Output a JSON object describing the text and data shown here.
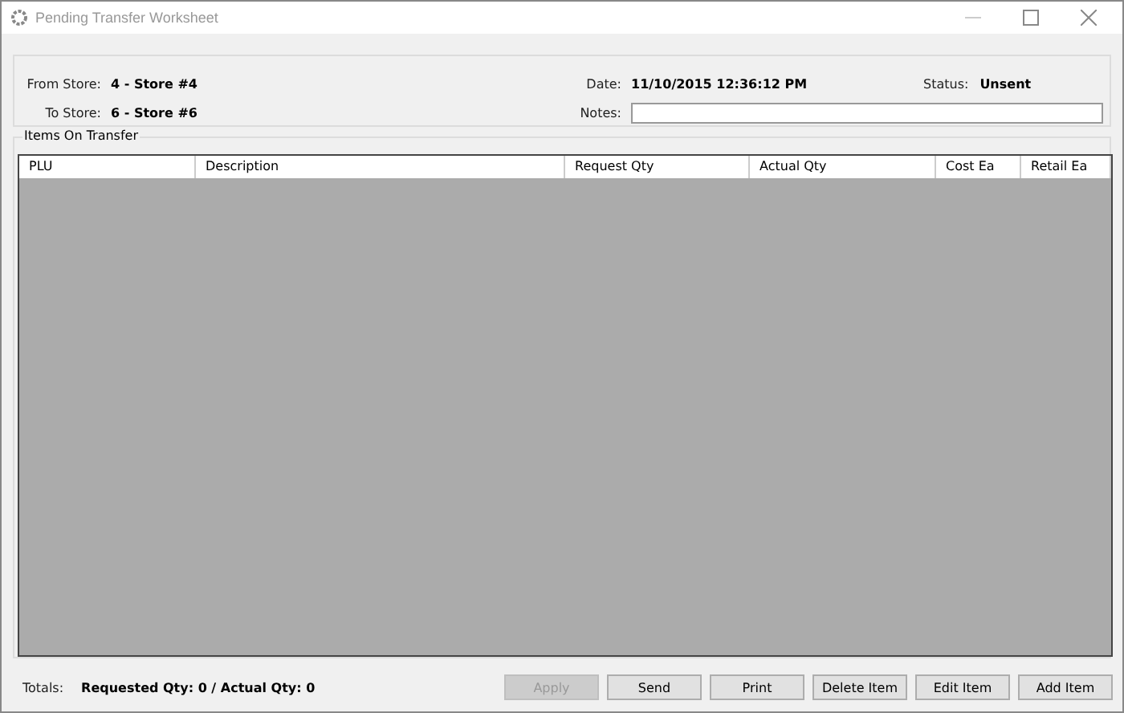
{
  "window": {
    "title": "Pending Transfer Worksheet"
  },
  "header": {
    "from_store_label": "From Store:",
    "from_store": "4 - Store #4",
    "to_store_label": "To Store:",
    "to_store": "6 - Store #6",
    "date_label": "Date:",
    "date": "11/10/2015 12:36:12 PM",
    "status_label": "Status:",
    "status": "Unsent",
    "notes_label": "Notes:"
  },
  "items_group": {
    "title": "Items On Transfer",
    "columns": [
      {
        "label": "PLU"
      },
      {
        "label": "Description"
      },
      {
        "label": "Request Qty"
      },
      {
        "label": "Actual Qty"
      },
      {
        "label": "Cost Ea"
      },
      {
        "label": "Retail Ea"
      }
    ]
  },
  "footer": {
    "totals_label": "Totals:",
    "totals": "Requested Qty: 0 / Actual Qty: 0",
    "buttons": [
      {
        "label": "Apply",
        "disabled": true
      },
      {
        "label": "Send",
        "disabled": false
      },
      {
        "label": "Print",
        "disabled": false
      },
      {
        "label": "Delete Item",
        "disabled": false
      },
      {
        "label": "Edit Item",
        "disabled": false
      },
      {
        "label": "Add Item",
        "disabled": false
      }
    ]
  }
}
